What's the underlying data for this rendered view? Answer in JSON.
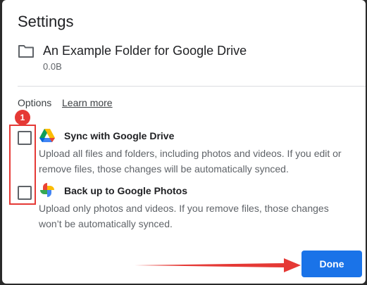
{
  "dialog": {
    "title": "Settings",
    "folder": {
      "icon": "folder-outline-icon",
      "name": "An Example Folder for Google Drive",
      "size": "0.0B"
    },
    "options": {
      "label": "Options",
      "learn_more": "Learn more",
      "items": [
        {
          "icon": "google-drive-icon",
          "title": "Sync with Google Drive",
          "description": "Upload all files and folders, including photos and videos. If you edit or remove files, those changes will be automatically synced.",
          "checked": false
        },
        {
          "icon": "google-photos-icon",
          "title": "Back up to Google Photos",
          "description": "Upload only photos and videos. If you remove files, those changes won’t be automatically synced.",
          "checked": false
        }
      ]
    },
    "done_label": "Done"
  },
  "annotations": {
    "badge": "1",
    "highlight_color": "#e53935"
  },
  "colors": {
    "primary": "#1a73e8",
    "text": "#202124",
    "secondary_text": "#5f6368"
  }
}
